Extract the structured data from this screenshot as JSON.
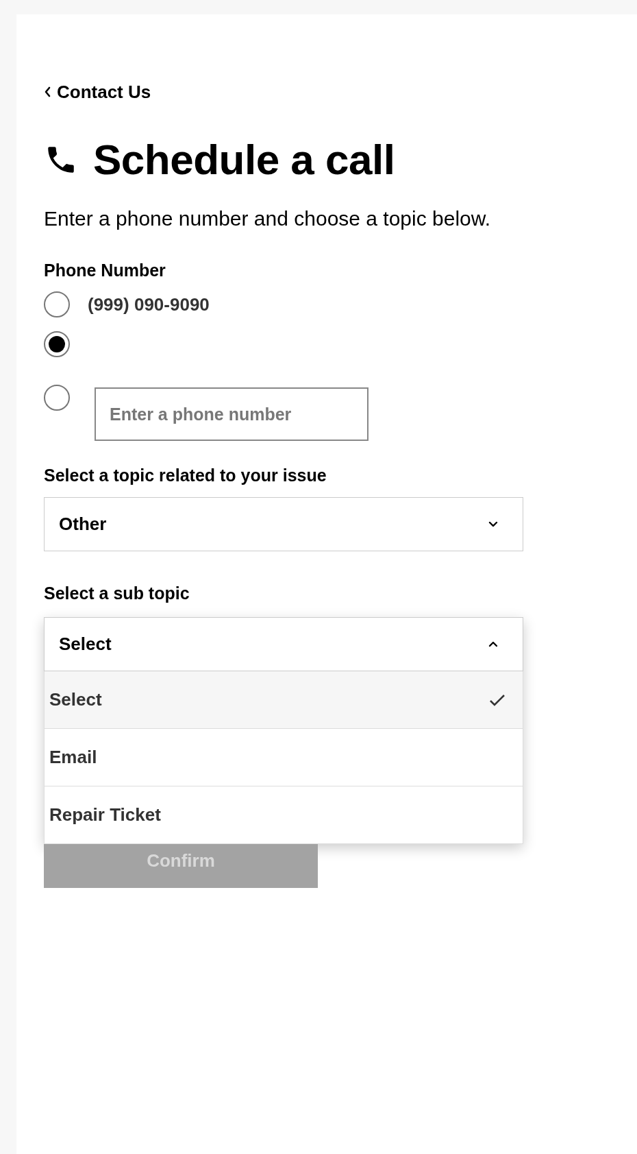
{
  "back_link": {
    "label": "Contact Us"
  },
  "heading": "Schedule a call",
  "intro": "Enter a phone number and choose a topic below.",
  "phone_number": {
    "label": "Phone Number",
    "options": [
      {
        "kind": "label",
        "label": "(999) 090-9090",
        "selected": false
      },
      {
        "kind": "blank",
        "selected": true
      },
      {
        "kind": "input",
        "placeholder": "Enter a phone number",
        "selected": false
      }
    ]
  },
  "topic": {
    "label": "Select a topic related to your issue",
    "value": "Other",
    "expanded": false
  },
  "sub_topic": {
    "label": "Select a sub topic",
    "value": "Select",
    "expanded": true,
    "options": [
      {
        "label": "Select",
        "selected": true
      },
      {
        "label": "Email",
        "selected": false
      },
      {
        "label": "Repair Ticket",
        "selected": false
      }
    ]
  },
  "confirm_button": {
    "label": "Confirm",
    "disabled": true
  }
}
